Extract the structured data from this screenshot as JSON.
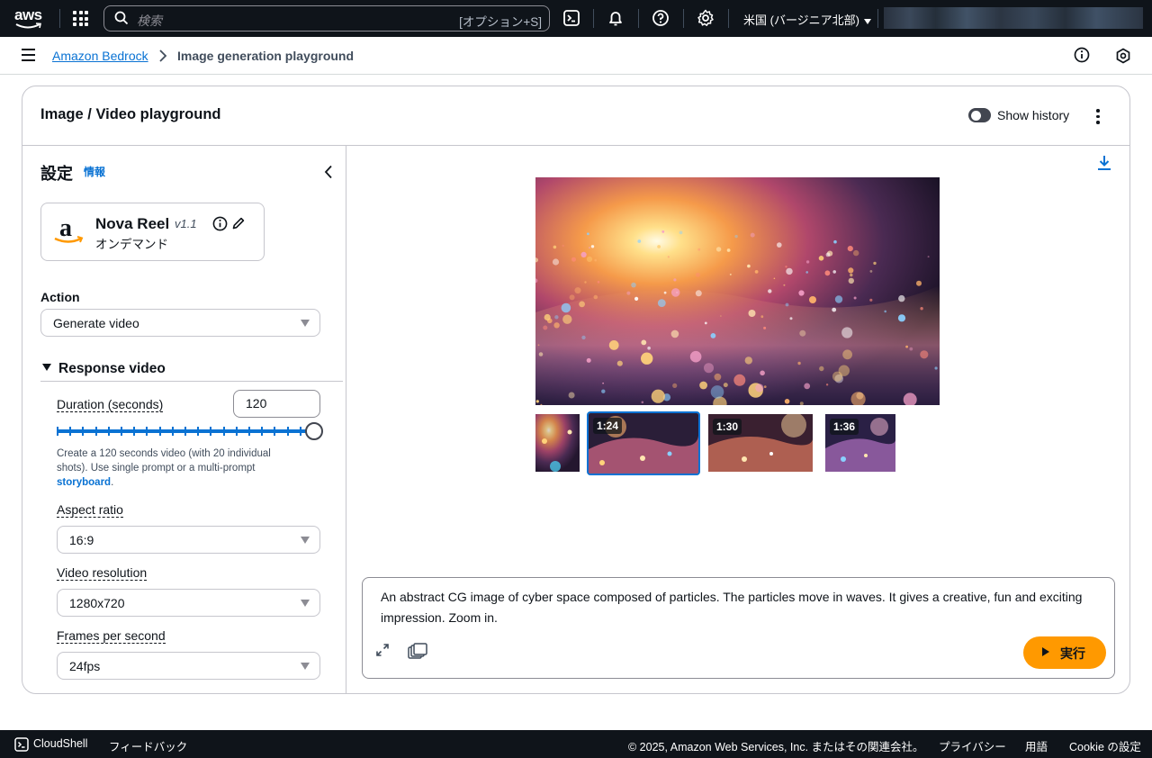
{
  "topnav": {
    "logo_text": "aws",
    "search_placeholder": "検索",
    "search_shortcut": "[オプション+S]",
    "region": "米国 (バージニア北部)",
    "icons": [
      "apps-grid-icon",
      "search-icon",
      "cloudshell-icon",
      "bell-icon",
      "help-icon",
      "gear-icon"
    ]
  },
  "breadcrumb": {
    "items": [
      "Amazon Bedrock",
      "Image generation playground"
    ]
  },
  "card": {
    "title": "Image / Video playground",
    "show_history_label": "Show history",
    "show_history_on": false
  },
  "settings": {
    "title": "設定",
    "info_link": "情報",
    "model": {
      "name": "Nova Reel",
      "version": "v1.1",
      "mode": "オンデマンド"
    },
    "action": {
      "label": "Action",
      "value": "Generate video"
    },
    "section_title": "Response video",
    "duration": {
      "label": "Duration (seconds)",
      "value": "120",
      "fraction": 1.0
    },
    "help": {
      "text": "Create a 120 seconds video (with 20 individual shots). Use single prompt or a multi-prompt",
      "link": "storyboard",
      "end": "."
    },
    "aspect_ratio": {
      "label": "Aspect ratio",
      "value": "16:9"
    },
    "resolution": {
      "label": "Video resolution",
      "value": "1280x720"
    },
    "fps": {
      "label": "Frames per second",
      "value": "24fps"
    }
  },
  "output": {
    "thumbnails": [
      {
        "time": ""
      },
      {
        "time": "1:24",
        "selected": true
      },
      {
        "time": "1:30"
      },
      {
        "time": "1:36"
      }
    ],
    "prompt": "An abstract CG image of cyber space composed of particles. The particles move in waves. It gives a creative, fun and exciting impression. Zoom in.",
    "run_label": "実行"
  },
  "footer": {
    "cloudshell": "CloudShell",
    "feedback": "フィードバック",
    "copyright": "© 2025, Amazon Web Services, Inc. またはその関連会社。",
    "privacy": "プライバシー",
    "terms": "用語",
    "cookie": "Cookie の設定"
  },
  "colors": {
    "accent": "#0972d3",
    "run_button": "#ff9900",
    "nav_bg": "#0f141a"
  }
}
